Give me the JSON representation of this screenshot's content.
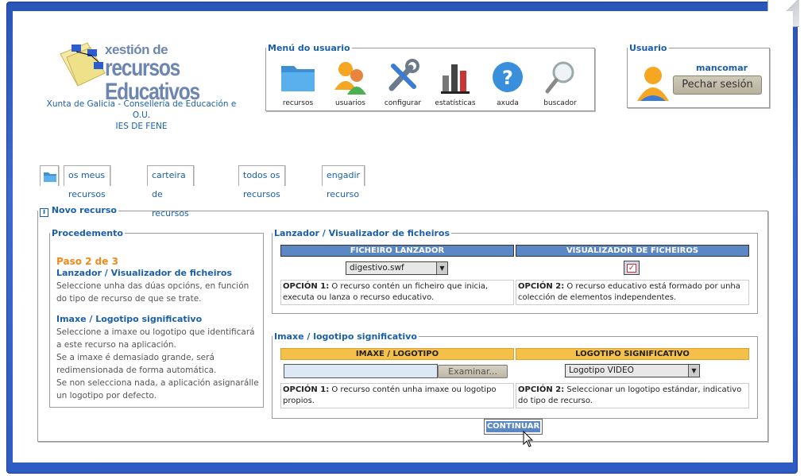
{
  "logo": {
    "line1": "xestión de",
    "line2": "recursos Educativos"
  },
  "org": {
    "line1": "Xunta de Galicia - Consellería de Educación e O.U.",
    "line2": "IES DE FENE"
  },
  "menu": {
    "legend": "Menú do usuario",
    "items": [
      {
        "label": "recursos",
        "icon": "folder-icon"
      },
      {
        "label": "usuarios",
        "icon": "users-icon"
      },
      {
        "label": "configurar",
        "icon": "tools-icon"
      },
      {
        "label": "estatísticas",
        "icon": "bar-chart-icon"
      },
      {
        "label": "axuda",
        "icon": "help-icon"
      },
      {
        "label": "buscador",
        "icon": "magnifier-icon"
      }
    ]
  },
  "user": {
    "legend": "Usuario",
    "name": "mancomar",
    "logout_label": "Pechar sesión"
  },
  "tabs": [
    {
      "label": "os meus recursos"
    },
    {
      "label": "carteira de recursos"
    },
    {
      "label": "todos os recursos"
    },
    {
      "label": "engadir recurso"
    }
  ],
  "new_resource": {
    "legend": "Novo recurso",
    "procedure": {
      "legend": "Procedemento",
      "step": "Paso 2 de 3",
      "s1_title": "Lanzador / Visualizador de ficheiros",
      "s1_text": "Seleccione unha das dúas opcións, en función do tipo de recurso de que se trate.",
      "s2_title": "Imaxe / Logotipo significativo",
      "s2_text1": "Seleccione a imaxe ou logotipo que identificará a este recurso na aplicación.",
      "s2_text2": "Se a imaxe é demasiado grande, será redimensionada de forma automática.",
      "s2_text3": "Se non selecciona nada, a aplicación asignarálle un logotipo por defecto."
    },
    "launcher": {
      "legend": "Lanzador / Visualizador de ficheiros",
      "col1_header": "FICHEIRO LANZADOR",
      "col2_header": "VISUALIZADOR DE FICHEIROS",
      "select_value": "digestivo.swf",
      "opt1_label": "OPCIÓN 1:",
      "opt1_text": " O recurso contén un ficheiro que inicia, executa ou lanza o recurso educativo.",
      "opt2_label": "OPCIÓN 2:",
      "opt2_text": " O recurso educativo está formado por unha colección de elementos independentes.",
      "checkbox_checked": true
    },
    "image": {
      "legend": "Imaxe / logotipo significativo",
      "col1_header": "IMAXE / LOGOTIPO",
      "col2_header": "LOGOTIPO SIGNIFICATIVO",
      "file_value": "",
      "browse_label": "Examinar...",
      "logo_select_value": "Logotipo VIDEO",
      "opt1_label": "OPCIÓN 1:",
      "opt1_text": " O recurso contén unha imaxe ou logotipo propios.",
      "opt2_label": "OPCIÓN 2:",
      "opt2_text": " Seleccionar un logotipo estándar, indicativo do tipo de recurso."
    },
    "continue_label": "CONTINUAR"
  },
  "colors": {
    "accent": "#1a5fa8",
    "step": "#f08a1c",
    "header_blue": "#5b87c5",
    "header_orange": "#f5c04a",
    "frame": "#2d5cc4"
  }
}
